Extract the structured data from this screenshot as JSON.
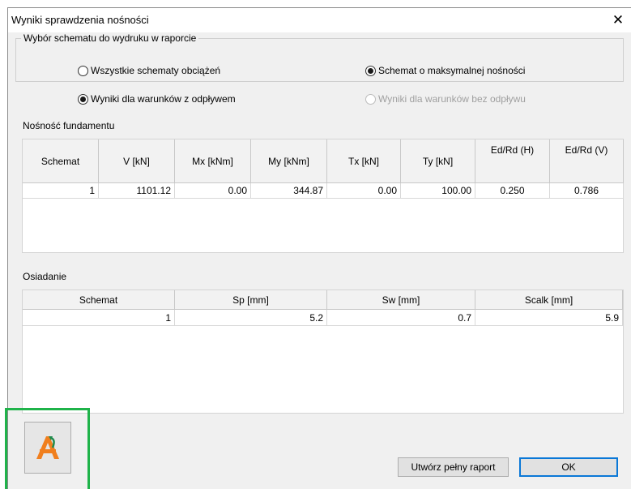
{
  "window": {
    "title": "Wyniki sprawdzenia nośności",
    "close_icon": "close-icon"
  },
  "report_group": {
    "legend": "Wybór schematu do wydruku w raporcie",
    "options": [
      {
        "label": "Wszystkie schematy obciążeń",
        "checked": false,
        "enabled": true
      },
      {
        "label": "Schemat o maksymalnej nośności",
        "checked": true,
        "enabled": true
      },
      {
        "label": "Wyniki dla warunków z odpływem",
        "checked": true,
        "enabled": true
      },
      {
        "label": "Wyniki dla warunków bez odpływu",
        "checked": false,
        "enabled": false
      }
    ]
  },
  "capacity": {
    "label": "Nośność fundamentu",
    "columns": [
      "Schemat",
      "V [kN]",
      "Mx [kNm]",
      "My [kNm]",
      "Tx [kN]",
      "Ty [kN]",
      "Ed/Rd (H)",
      "Ed/Rd (V)"
    ],
    "rows": [
      [
        "1",
        "1101.12",
        "0.00",
        "344.87",
        "0.00",
        "100.00",
        "0.250",
        "0.786"
      ]
    ]
  },
  "settlement": {
    "label": "Osiadanie",
    "columns": [
      "Schemat",
      "Sp [mm]",
      "Sw [mm]",
      "Scalk [mm]"
    ],
    "rows": [
      [
        "1",
        "5.2",
        "0.7",
        "5.9"
      ]
    ]
  },
  "footer": {
    "app_icon": "app-logo-icon",
    "report_button": "Utwórz pełny raport",
    "ok_button": "OK"
  },
  "colors": {
    "dialog_bg": "#f0f0f0",
    "highlight": "#1fb34a",
    "default_button_border": "#0a78d7",
    "logo_orange": "#f07f1e"
  }
}
